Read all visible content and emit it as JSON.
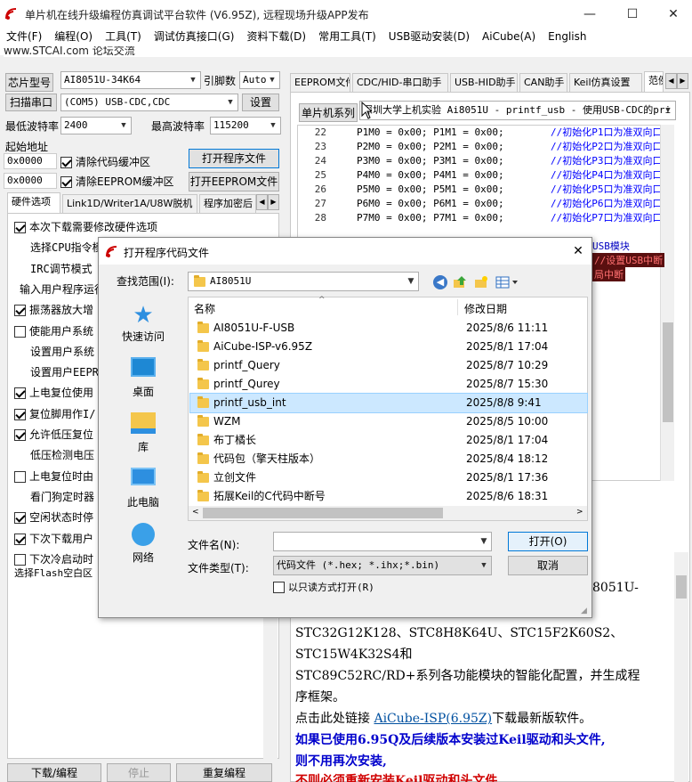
{
  "window": {
    "title": "单片机在线升级编程仿真调试平台软件 (V6.95Z), 远程现场升级APP发布",
    "subtitle": "www.STCAI.com 论坛交流",
    "minimize": "—",
    "maximize": "☐",
    "close": "✕"
  },
  "menu": [
    "文件(F)",
    "编程(O)",
    "工具(T)",
    "调试仿真接口(G)",
    "资料下载(D)",
    "常用工具(T)",
    "USB驱动安装(D)",
    "AiCube(A)",
    "English"
  ],
  "left": {
    "chip_label": "芯片型号",
    "chip_value": "AI8051U-34K64",
    "pins_label": "引脚数",
    "pins_value": "Auto",
    "scan_button": "扫描串口",
    "port_value": "(COM5) USB-CDC,CDC",
    "settings_button": "设置",
    "min_baud_label": "最低波特率",
    "min_baud_value": "2400",
    "max_baud_label": "最高波特率",
    "max_baud_value": "115200",
    "start_addr_label": "起始地址",
    "addr1": "0x0000",
    "clear_code_cb": "清除代码缓冲区",
    "open_prog_button": "打开程序文件",
    "addr2": "0x0000",
    "clear_eeprom_cb": "清除EEPROM缓冲区",
    "open_eeprom_button": "打开EEPROM文件",
    "tabs": [
      "硬件选项",
      "Link1D/Writer1A/U8W脱机",
      "程序加密后"
    ],
    "options": [
      {
        "text": "本次下载需要修改硬件选项",
        "cb": true,
        "on": true
      },
      {
        "text": "选择CPU指令模",
        "cb": false,
        "on": false
      },
      {
        "text": "IRC调节模式",
        "cb": false,
        "on": false
      },
      {
        "text": "输入用户程序运行",
        "cb": false,
        "on": false
      },
      {
        "text": "振荡器放大增",
        "cb": true,
        "on": true
      },
      {
        "text": "使能用户系统",
        "cb": true,
        "on": false
      },
      {
        "text": "设置用户系统",
        "cb": false,
        "on": false
      },
      {
        "text": "设置用户EEPRO",
        "cb": false,
        "on": false
      },
      {
        "text": "上电复位使用",
        "cb": true,
        "on": true
      },
      {
        "text": "复位脚用作I/",
        "cb": true,
        "on": true
      },
      {
        "text": "允许低压复位",
        "cb": true,
        "on": true
      },
      {
        "text": "低压检测电压",
        "cb": false,
        "on": false
      },
      {
        "text": "上电复位时由",
        "cb": true,
        "on": false
      },
      {
        "text": "看门狗定时器",
        "cb": false,
        "on": false
      },
      {
        "text": "空闲状态时停",
        "cb": true,
        "on": true
      },
      {
        "text": "下次下载用户",
        "cb": true,
        "on": true
      },
      {
        "text": "下次冷启动时",
        "cb": true,
        "on": false
      }
    ],
    "flash_label": "选择Flash空白区",
    "bottom_buttons": [
      "下载/编程",
      "停止",
      "重复编程"
    ]
  },
  "right": {
    "tabs": [
      "EEPROM文件",
      "CDC/HID-串口助手",
      "USB-HID助手",
      "CAN助手",
      "Keil仿真设置",
      "范例"
    ],
    "series_label": "单片机系列",
    "series_value": "深圳大学上机实验 Ai8051U - printf_usb - 使用USB-CDC的pri",
    "code": [
      {
        "n": "22",
        "text": "P1M0 = 0x00; P1M1 = 0x00;",
        "cm": "//初始化P1口为准双向口"
      },
      {
        "n": "23",
        "text": "P2M0 = 0x00; P2M1 = 0x00;",
        "cm": "//初始化P2口为准双向口"
      },
      {
        "n": "24",
        "text": "P3M0 = 0x00; P3M1 = 0x00;",
        "cm": "//初始化P3口为准双向口"
      },
      {
        "n": "25",
        "text": "P4M0 = 0x00; P4M1 = 0x00;",
        "cm": "//初始化P4口为准双向口"
      },
      {
        "n": "26",
        "text": "P5M0 = 0x00; P5M1 = 0x00;",
        "cm": "//初始化P5口为准双向口"
      },
      {
        "n": "27",
        "text": "P6M0 = 0x00; P6M1 = 0x00;",
        "cm": "//初始化P6口为准双向口"
      },
      {
        "n": "28",
        "text": "P7M0 = 0x00; P7M1 = 0x00;",
        "cm": "//初始化P7口为准双向口"
      }
    ],
    "code_frag1": "USB模块",
    "code_frag2": "//设置USB中断",
    "code_frag3": "局中断",
    "info_frag": "8051U-",
    "info_line1": "STC32G12K128、STC8H8K64U、STC15F2K60S2、",
    "info_line2": "STC15W4K32S4和",
    "info_line3": "STC89C52RC/RD+系列各功能模块的智能化配置，并生成程",
    "info_line4": "序框架。",
    "info_line5_pre": "点击此处链接 ",
    "info_link": "AiCube-ISP(6.95Z)",
    "info_line5_post": "下载最新版软件。",
    "info_line6": "如果已使用6.95Q及后续版本安装过Keil驱动和头文件,",
    "info_line7": "则不用再次安装,",
    "info_line8": "不则必须重新安装Keil驱动和头文件"
  },
  "dialog": {
    "title": "打开程序代码文件",
    "close": "✕",
    "lookin_label": "查找范围(I):",
    "lookin_value": "AI8051U",
    "places": [
      "快速访问",
      "桌面",
      "库",
      "此电脑",
      "网络"
    ],
    "col_name": "名称",
    "col_date": "修改日期",
    "files": [
      {
        "name": "AI8051U-F-USB",
        "date": "2025/8/6 11:11"
      },
      {
        "name": "AiCube-ISP-v6.95Z",
        "date": "2025/8/1 17:04"
      },
      {
        "name": "printf_Query",
        "date": "2025/8/7 10:29"
      },
      {
        "name": "printf_Qurey",
        "date": "2025/8/7 15:30"
      },
      {
        "name": "printf_usb_int",
        "date": "2025/8/8 9:41"
      },
      {
        "name": "WZM",
        "date": "2025/8/5 10:00"
      },
      {
        "name": "布丁橘长",
        "date": "2025/8/1 17:04"
      },
      {
        "name": "代码包（擎天柱版本）",
        "date": "2025/8/4 18:12"
      },
      {
        "name": "立创文件",
        "date": "2025/8/1 17:36"
      },
      {
        "name": "拓展Keil的C代码中断号",
        "date": "2025/8/6 18:31"
      }
    ],
    "selected_index": 4,
    "filename_label": "文件名(N):",
    "filename_value": "",
    "filetype_label": "文件类型(T):",
    "filetype_value": "代码文件 (*.hex; *.ihx;*.bin)",
    "readonly_label": "以只读方式打开(R)",
    "open_button": "打开(O)",
    "cancel_button": "取消"
  },
  "colors": {
    "selection": "#cce8ff",
    "selection_border": "#99d1ff",
    "comment": "#0000ff",
    "highlight_bg": "#5a1010",
    "highlight_text": "#ff7070"
  }
}
